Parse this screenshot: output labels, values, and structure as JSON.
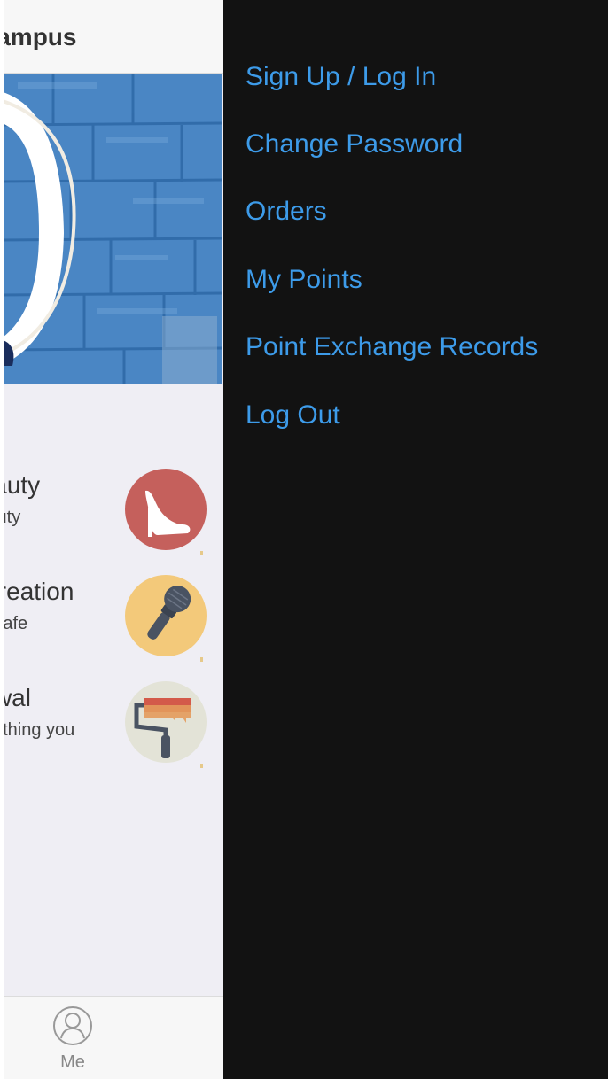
{
  "main": {
    "header_title": "Campus",
    "categories": [
      {
        "title": "Beauty",
        "subtitle": "Shoes & beauty",
        "icon": "high-heel-icon",
        "color": "#c5605c"
      },
      {
        "title": "Recreation",
        "subtitle": "KTV & cafe",
        "icon": "microphone-icon",
        "color": "#f3c97a"
      },
      {
        "title": "Renewal",
        "subtitle": "Everything you",
        "icon": "paint-roller-icon",
        "color": "#e3e3d7"
      }
    ],
    "tabbar": {
      "me_label": "Me",
      "me_icon": "user-icon"
    }
  },
  "drawer": {
    "items": [
      {
        "label": "Sign Up / Log In"
      },
      {
        "label": "Change Password"
      },
      {
        "label": "Orders"
      },
      {
        "label": "My Points"
      },
      {
        "label": "Point Exchange Records"
      },
      {
        "label": "Log Out"
      }
    ],
    "link_color": "#3d9be9",
    "background": "#121212"
  }
}
